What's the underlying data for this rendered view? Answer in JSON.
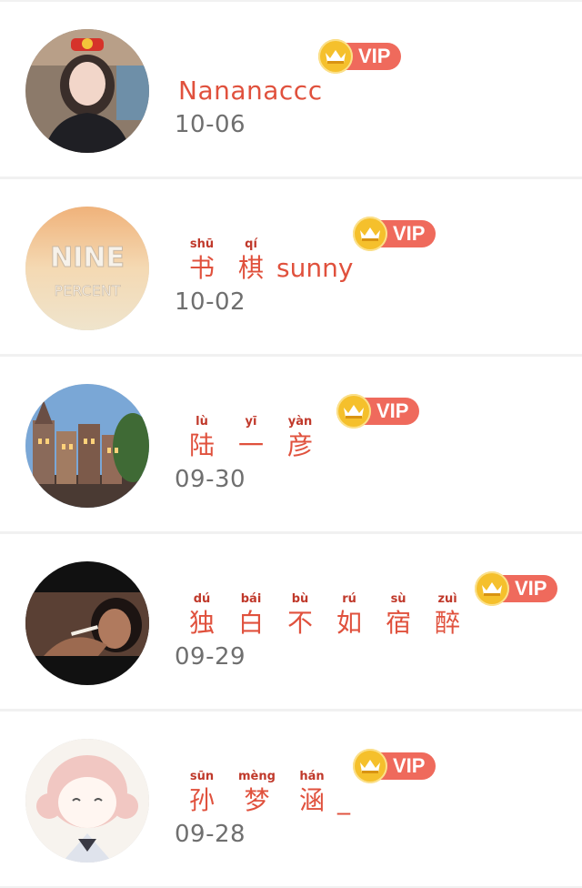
{
  "vip_label": "VIP",
  "colors": {
    "accent": "#e0513d",
    "vip_pill": "#ef6a5c",
    "crown": "#f5c02c",
    "date": "#6f6f6f",
    "separator": "#f1f1f1"
  },
  "items": [
    {
      "name": "Nananaccc",
      "date": "10-06",
      "avatar": "girl-selfie-avatar"
    },
    {
      "name_chars": [
        {
          "py": "shū",
          "hz": "书"
        },
        {
          "py": "qí",
          "hz": "棋"
        }
      ],
      "name_tail": "sunny",
      "date": "10-02",
      "avatar": "nine-percent-avatar"
    },
    {
      "name_chars": [
        {
          "py": "lù",
          "hz": "陆"
        },
        {
          "py": "yī",
          "hz": "一"
        },
        {
          "py": "yàn",
          "hz": "彦"
        }
      ],
      "date": "09-30",
      "avatar": "city-buildings-avatar"
    },
    {
      "name_chars": [
        {
          "py": "dú",
          "hz": "独"
        },
        {
          "py": "bái",
          "hz": "白"
        },
        {
          "py": "bù",
          "hz": "不"
        },
        {
          "py": "rú",
          "hz": "如"
        },
        {
          "py": "sù",
          "hz": "宿"
        },
        {
          "py": "zuì",
          "hz": "醉"
        }
      ],
      "date": "09-29",
      "avatar": "woman-smoking-avatar"
    },
    {
      "name_chars": [
        {
          "py": "sūn",
          "hz": "孙"
        },
        {
          "py": "mèng",
          "hz": "梦"
        },
        {
          "py": "hán",
          "hz": "涵"
        }
      ],
      "name_tail": "_",
      "date": "09-28",
      "avatar": "anime-girl-avatar"
    }
  ]
}
